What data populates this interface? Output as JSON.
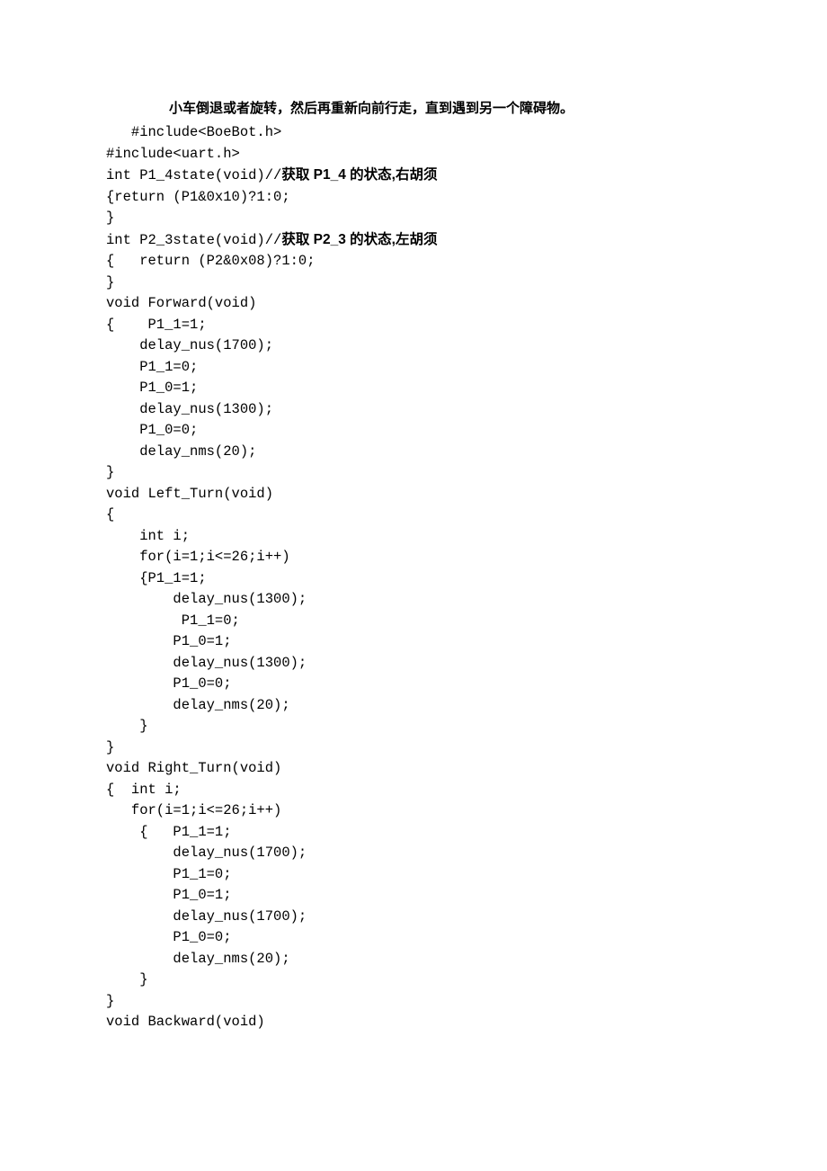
{
  "title": "小车倒退或者旋转，然后再重新向前行走，直到遇到另一个障碍物。",
  "code": {
    "l1": "   #include<BoeBot.h>",
    "l2": "#include<uart.h>",
    "l3a": "int P1_4state(void)//",
    "l3b": "获取 P1_4 的状态,右胡须",
    "l4": "{return (P1&0x10)?1:0;",
    "l5": "}",
    "l6a": "int P2_3state(void)//",
    "l6b": "获取 P2_3 的状态,左胡须",
    "l7": "{   return (P2&0x08)?1:0;",
    "l8": "}",
    "l9": "void Forward(void)",
    "l10": "{    P1_1=1;",
    "l11": "    delay_nus(1700);",
    "l12": "    P1_1=0;",
    "l13": "    P1_0=1;",
    "l14": "    delay_nus(1300);",
    "l15": "    P1_0=0;",
    "l16": "    delay_nms(20);",
    "l17": "}",
    "l18": "void Left_Turn(void)",
    "l19": "{",
    "l20": "    int i;",
    "l21": "    for(i=1;i<=26;i++)",
    "l22": "    {P1_1=1;",
    "l23": "        delay_nus(1300);",
    "l24": "         P1_1=0;",
    "l25": "        P1_0=1;",
    "l26": "        delay_nus(1300);",
    "l27": "        P1_0=0;",
    "l28": "        delay_nms(20);",
    "l29": "    }",
    "l30": "}",
    "l31": "void Right_Turn(void)",
    "l32": "{  int i;",
    "l33": "   for(i=1;i<=26;i++)",
    "l34": "    {   P1_1=1;",
    "l35": "        delay_nus(1700);",
    "l36": "        P1_1=0;",
    "l37": "        P1_0=1;",
    "l38": "        delay_nus(1700);",
    "l39": "        P1_0=0;",
    "l40": "        delay_nms(20);",
    "l41": "    }",
    "l42": "}",
    "l43": "void Backward(void)"
  }
}
